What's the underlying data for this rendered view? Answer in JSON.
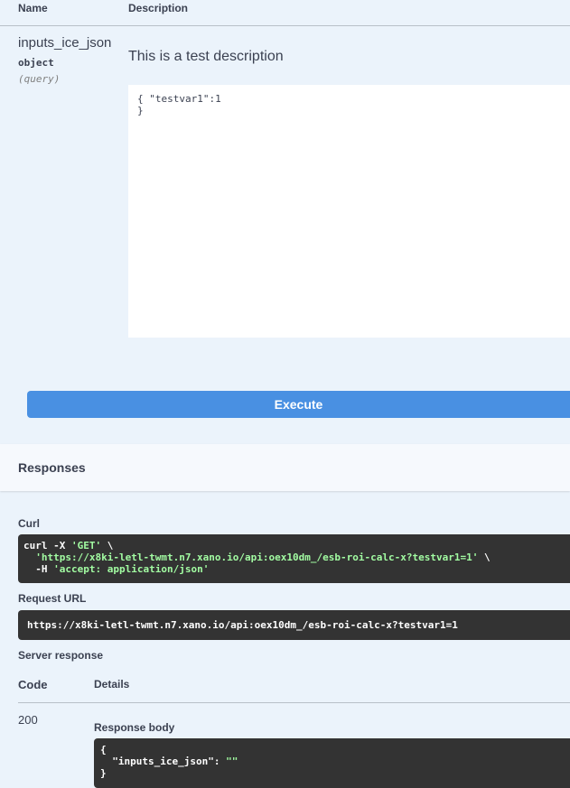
{
  "params": {
    "header": {
      "name": "Name",
      "description": "Description"
    },
    "item": {
      "name": "inputs_ice_json",
      "type": "object",
      "in": "(query)",
      "description": "This is a test description",
      "value": "{ \"testvar1\":1\n}"
    }
  },
  "execute_label": "Execute",
  "responses": {
    "title": "Responses",
    "curl_label": "Curl",
    "curl": {
      "line1_pre": "curl -X ",
      "line1_method": "'GET'",
      "line1_post": " \\",
      "line2_url": "'https://x8ki-letl-twmt.n7.xano.io/api:oex10dm_/esb-roi-calc-x?testvar1=1'",
      "line2_post": " \\",
      "line3_pre": "  -H ",
      "line3_header": "'accept: application/json'"
    },
    "request_url_label": "Request URL",
    "request_url": "https://x8ki-letl-twmt.n7.xano.io/api:oex10dm_/esb-roi-calc-x?testvar1=1",
    "server_response_label": "Server response",
    "table": {
      "code_header": "Code",
      "details_header": "Details"
    },
    "status_code": "200",
    "response_body_label": "Response body",
    "body": {
      "open": "{",
      "key": "  \"inputs_ice_json\": ",
      "value": "\"\"",
      "close": "}"
    }
  },
  "colors": {
    "background": "#ebf3fb",
    "execute": "#4990e2",
    "code_bg": "#333333",
    "string": "#a2fca2"
  }
}
